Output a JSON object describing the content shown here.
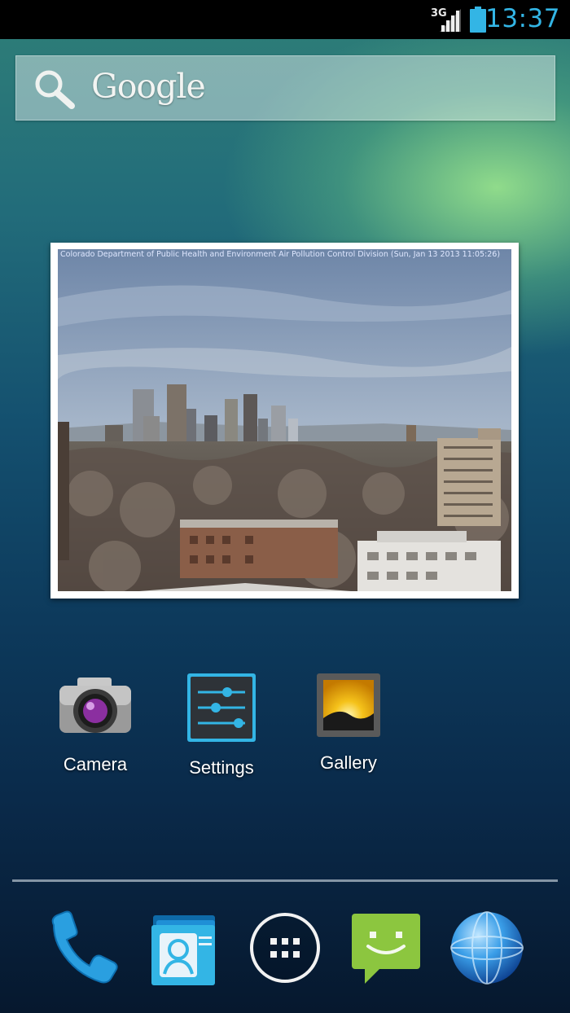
{
  "status_bar": {
    "network_type": "3G",
    "time": "13:37",
    "signal_icon": "signal-bars-icon",
    "battery_icon": "battery-icon"
  },
  "search_widget": {
    "logo_text": "Google",
    "icon": "search-icon"
  },
  "photo_widget": {
    "caption": "Colorado Department of Public Health and Environment Air Pollution Control Division (Sun, Jan 13 2013 11:05:26)"
  },
  "apps": [
    {
      "label": "Camera",
      "icon": "camera-icon"
    },
    {
      "label": "Settings",
      "icon": "settings-sliders-icon"
    },
    {
      "label": "Gallery",
      "icon": "gallery-icon"
    }
  ],
  "dock": [
    {
      "icon": "phone-icon"
    },
    {
      "icon": "contacts-icon"
    },
    {
      "icon": "app-drawer-icon"
    },
    {
      "icon": "messaging-icon"
    },
    {
      "icon": "browser-globe-icon"
    }
  ],
  "colors": {
    "accent": "#33b5e5",
    "status_bar_bg": "#000000",
    "messaging_green": "#8cc63f"
  }
}
